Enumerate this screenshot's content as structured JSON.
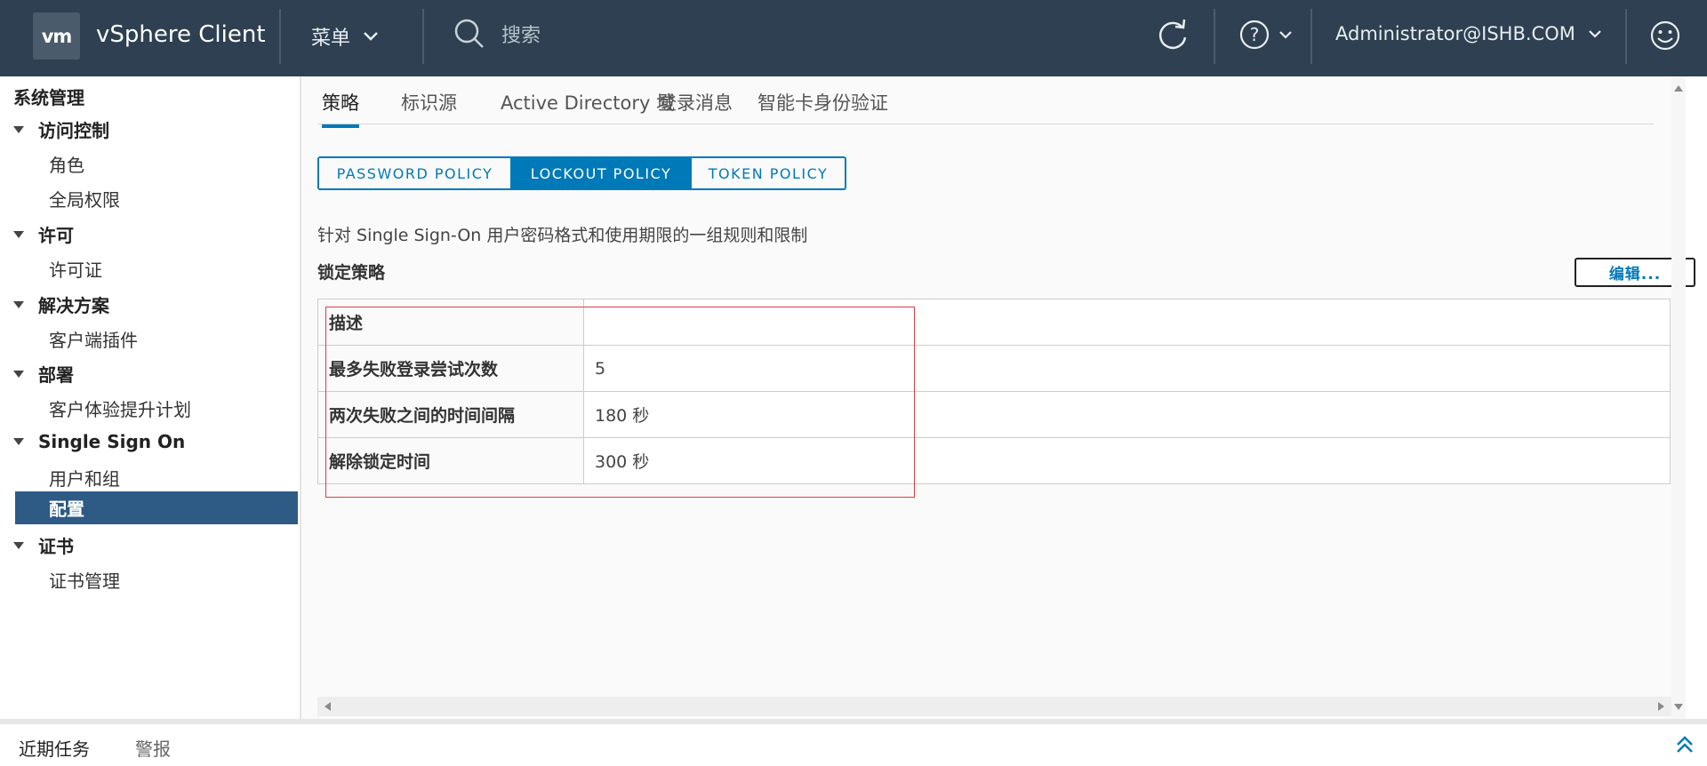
{
  "header": {
    "logo": "vm",
    "app_title": "vSphere Client",
    "menu_label": "菜单",
    "search_placeholder": "搜索",
    "user": "Administrator@ISHB.COM"
  },
  "sidebar": {
    "title": "系统管理",
    "groups": [
      {
        "label": "访问控制",
        "items": [
          "角色",
          "全局权限"
        ]
      },
      {
        "label": "许可",
        "items": [
          "许可证"
        ]
      },
      {
        "label": "解决方案",
        "items": [
          "客户端插件"
        ]
      },
      {
        "label": "部署",
        "items": [
          "客户体验提升计划"
        ]
      },
      {
        "label": "Single Sign On",
        "items": [
          "用户和组",
          "配置"
        ]
      },
      {
        "label": "证书",
        "items": [
          "证书管理"
        ]
      }
    ],
    "selected_item": "配置"
  },
  "main": {
    "tabs": [
      "策略",
      "标识源",
      "Active Directory 域",
      "登录消息",
      "智能卡身份验证"
    ],
    "active_tab": "策略",
    "policy_buttons": [
      "PASSWORD POLICY",
      "LOCKOUT POLICY",
      "TOKEN POLICY"
    ],
    "active_policy": "LOCKOUT POLICY",
    "description": "针对 Single Sign-On 用户密码格式和使用期限的一组规则和限制",
    "section_title": "锁定策略",
    "edit_label": "编辑...",
    "table": [
      {
        "key": "描述",
        "value": ""
      },
      {
        "key": "最多失败登录尝试次数",
        "value": "5"
      },
      {
        "key": "两次失败之间的时间间隔",
        "value": "180 秒"
      },
      {
        "key": "解除锁定时间",
        "value": "300 秒"
      }
    ]
  },
  "bottom": {
    "tabs": [
      "近期任务",
      "警报"
    ]
  },
  "colors": {
    "header_bg": "#2e4051",
    "accent": "#0079b8",
    "selected_bg": "#2e5a86",
    "highlight_box": "#e23c3c"
  }
}
